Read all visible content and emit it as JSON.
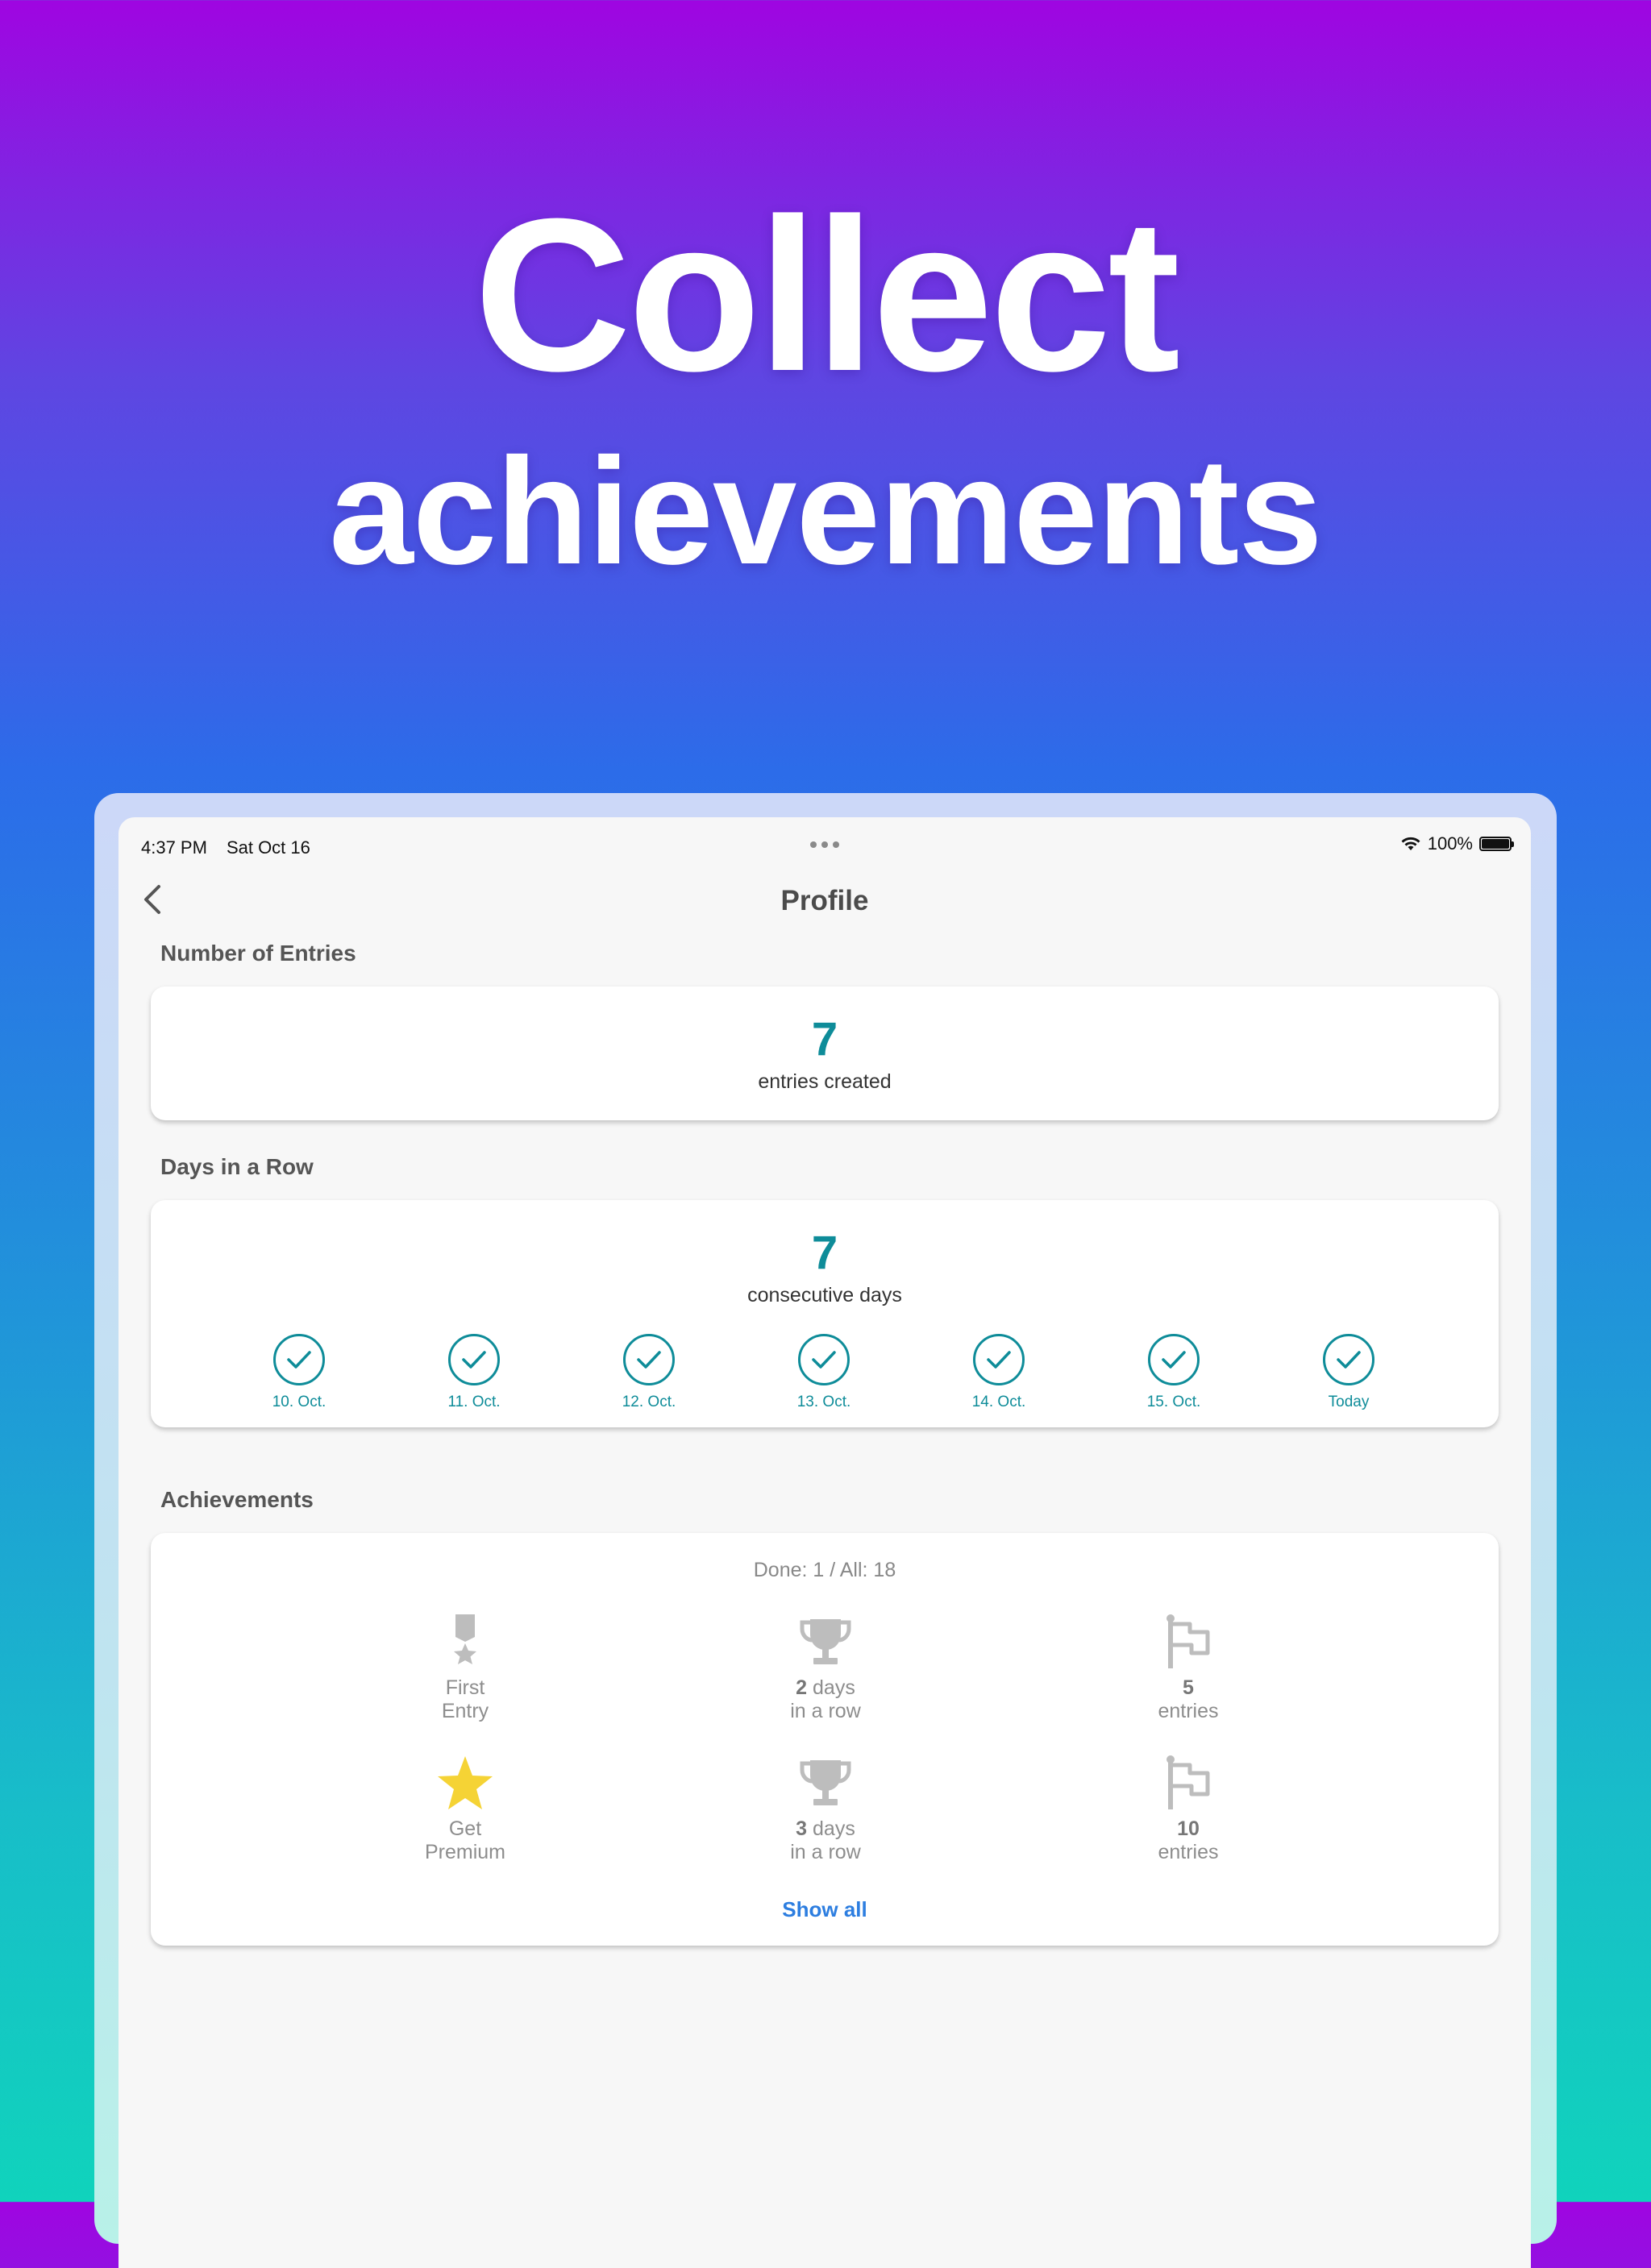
{
  "promo": {
    "line1": "Collect",
    "line2": "achievements"
  },
  "status_bar": {
    "time": "4:37 PM",
    "date": "Sat Oct 16",
    "battery": "100%"
  },
  "nav": {
    "title": "Profile"
  },
  "entries": {
    "label": "Number of Entries",
    "value": "7",
    "caption": "entries created"
  },
  "streak": {
    "label": "Days in a Row",
    "value": "7",
    "caption": "consecutive days",
    "days": [
      "10. Oct.",
      "11. Oct.",
      "12. Oct.",
      "13. Oct.",
      "14. Oct.",
      "15. Oct.",
      "Today"
    ]
  },
  "achievements": {
    "label": "Achievements",
    "summary": "Done: 1 / All: 18",
    "items": [
      {
        "icon": "medal-icon",
        "line1": "First",
        "line2": "Entry",
        "done": false
      },
      {
        "icon": "trophy-icon",
        "bold": "2",
        "line1": " days",
        "line2": "in a row",
        "done": false
      },
      {
        "icon": "flag-icon",
        "bold": "5",
        "line1": "",
        "line2": "entries",
        "done": false
      },
      {
        "icon": "star-icon",
        "line1": "Get",
        "line2": "Premium",
        "done": true
      },
      {
        "icon": "trophy-icon",
        "bold": "3",
        "line1": " days",
        "line2": "in a row",
        "done": false
      },
      {
        "icon": "flag-icon",
        "bold": "10",
        "line1": "",
        "line2": "entries",
        "done": false
      }
    ],
    "show_all": "Show all"
  },
  "colors": {
    "accent": "#0e8c99",
    "link": "#2d7ee0",
    "star": "#f5d335",
    "inactive": "#bdbdbd"
  }
}
